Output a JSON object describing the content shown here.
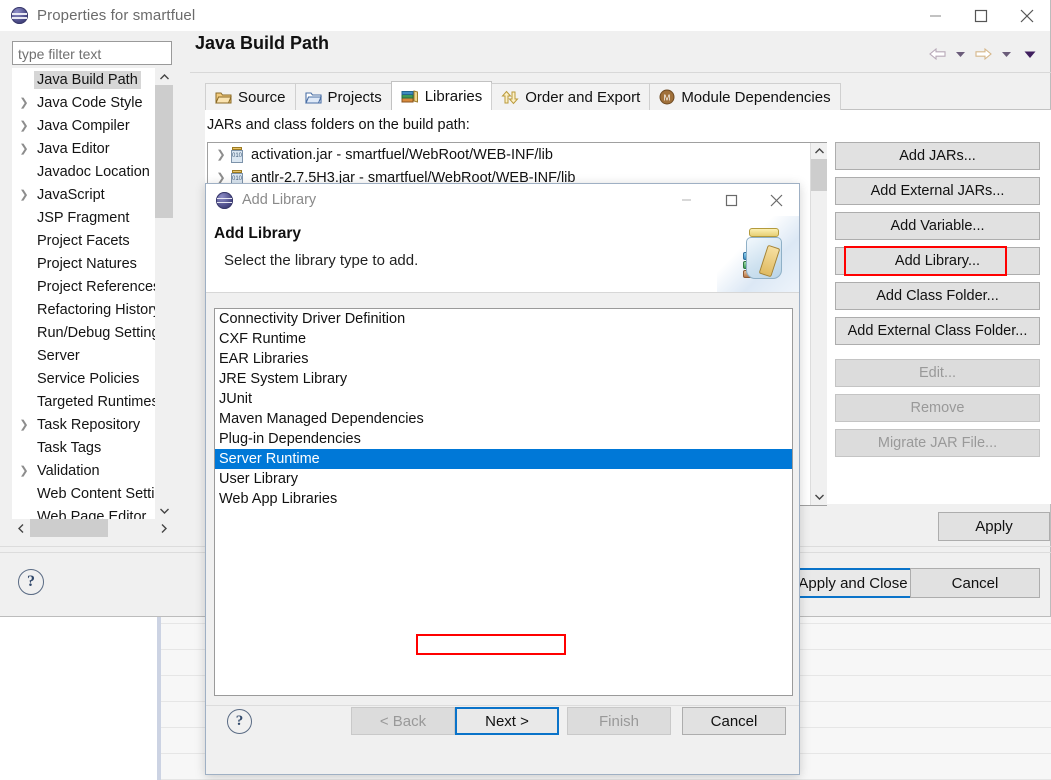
{
  "window": {
    "title": "Properties for smartfuel",
    "icon": "eclipse-icon",
    "minimize": "minimize-icon",
    "maximize": "maximize-icon",
    "close": "close-icon"
  },
  "sidebar": {
    "filter_placeholder": "type filter text",
    "filter_value": "type filter text",
    "items": [
      {
        "label": "Java Build Path",
        "expandable": false,
        "selected": true
      },
      {
        "label": "Java Code Style",
        "expandable": true,
        "selected": false
      },
      {
        "label": "Java Compiler",
        "expandable": true,
        "selected": false
      },
      {
        "label": "Java Editor",
        "expandable": true,
        "selected": false
      },
      {
        "label": "Javadoc Location",
        "expandable": false,
        "selected": false
      },
      {
        "label": "JavaScript",
        "expandable": true,
        "selected": false
      },
      {
        "label": "JSP Fragment",
        "expandable": false,
        "selected": false
      },
      {
        "label": "Project Facets",
        "expandable": false,
        "selected": false
      },
      {
        "label": "Project Natures",
        "expandable": false,
        "selected": false
      },
      {
        "label": "Project References",
        "expandable": false,
        "selected": false
      },
      {
        "label": "Refactoring History",
        "expandable": false,
        "selected": false
      },
      {
        "label": "Run/Debug Settings",
        "expandable": false,
        "selected": false
      },
      {
        "label": "Server",
        "expandable": false,
        "selected": false
      },
      {
        "label": "Service Policies",
        "expandable": false,
        "selected": false
      },
      {
        "label": "Targeted Runtimes",
        "expandable": false,
        "selected": false
      },
      {
        "label": "Task Repository",
        "expandable": true,
        "selected": false
      },
      {
        "label": "Task Tags",
        "expandable": false,
        "selected": false
      },
      {
        "label": "Validation",
        "expandable": true,
        "selected": false
      },
      {
        "label": "Web Content Settings",
        "expandable": false,
        "selected": false
      },
      {
        "label": "Web Page Editor",
        "expandable": false,
        "selected": false
      }
    ]
  },
  "content": {
    "page_title": "Java Build Path",
    "tabs": [
      {
        "label": "Source",
        "icon": "source-folder-icon",
        "active": false
      },
      {
        "label": "Projects",
        "icon": "projects-folder-icon",
        "active": false
      },
      {
        "label": "Libraries",
        "icon": "libraries-books-icon",
        "active": true
      },
      {
        "label": "Order and Export",
        "icon": "order-export-icon",
        "active": false
      },
      {
        "label": "Module Dependencies",
        "icon": "module-icon",
        "active": false
      }
    ],
    "jars_label": "JARs and class folders on the build path:",
    "jars": [
      {
        "label": "activation.jar - smartfuel/WebRoot/WEB-INF/lib"
      },
      {
        "label": "antlr-2.7.5H3.jar - smartfuel/WebRoot/WEB-INF/lib"
      }
    ],
    "buttons": [
      {
        "label": "Add JARs...",
        "enabled": true,
        "highlighted": false
      },
      {
        "label": "Add External JARs...",
        "enabled": true,
        "highlighted": false
      },
      {
        "label": "Add Variable...",
        "enabled": true,
        "highlighted": false
      },
      {
        "label": "Add Library...",
        "enabled": true,
        "highlighted": true
      },
      {
        "label": "Add Class Folder...",
        "enabled": true,
        "highlighted": false
      },
      {
        "label": "Add External Class Folder...",
        "enabled": true,
        "highlighted": false
      },
      {
        "label": "Edit...",
        "enabled": false,
        "highlighted": false
      },
      {
        "label": "Remove",
        "enabled": false,
        "highlighted": false
      },
      {
        "label": "Migrate JAR File...",
        "enabled": false,
        "highlighted": false
      }
    ],
    "apply_label": "Apply",
    "apply_and_close_label": "Apply and Close",
    "cancel_label": "Cancel",
    "help_icon": "help-icon"
  },
  "dialog": {
    "window_title": "Add Library",
    "heading": "Add Library",
    "description": "Select the library type to add.",
    "banner_icon": "jar-with-books-icon",
    "libraries": [
      {
        "label": "Connectivity Driver Definition",
        "selected": false
      },
      {
        "label": "CXF Runtime",
        "selected": false
      },
      {
        "label": "EAR Libraries",
        "selected": false
      },
      {
        "label": "JRE System Library",
        "selected": false
      },
      {
        "label": "JUnit",
        "selected": false
      },
      {
        "label": "Maven Managed Dependencies",
        "selected": false
      },
      {
        "label": "Plug-in Dependencies",
        "selected": false
      },
      {
        "label": "Server Runtime",
        "selected": true
      },
      {
        "label": "User Library",
        "selected": false
      },
      {
        "label": "Web App Libraries",
        "selected": false
      }
    ],
    "footer": {
      "back": "< Back",
      "next": "Next >",
      "finish": "Finish",
      "cancel": "Cancel",
      "help_icon": "help-icon"
    }
  },
  "colors": {
    "selection_blue": "#0078d7",
    "highlight_red": "#ff0000",
    "button_face": "#e1e1e1",
    "focus_border": "#0a73c9"
  }
}
